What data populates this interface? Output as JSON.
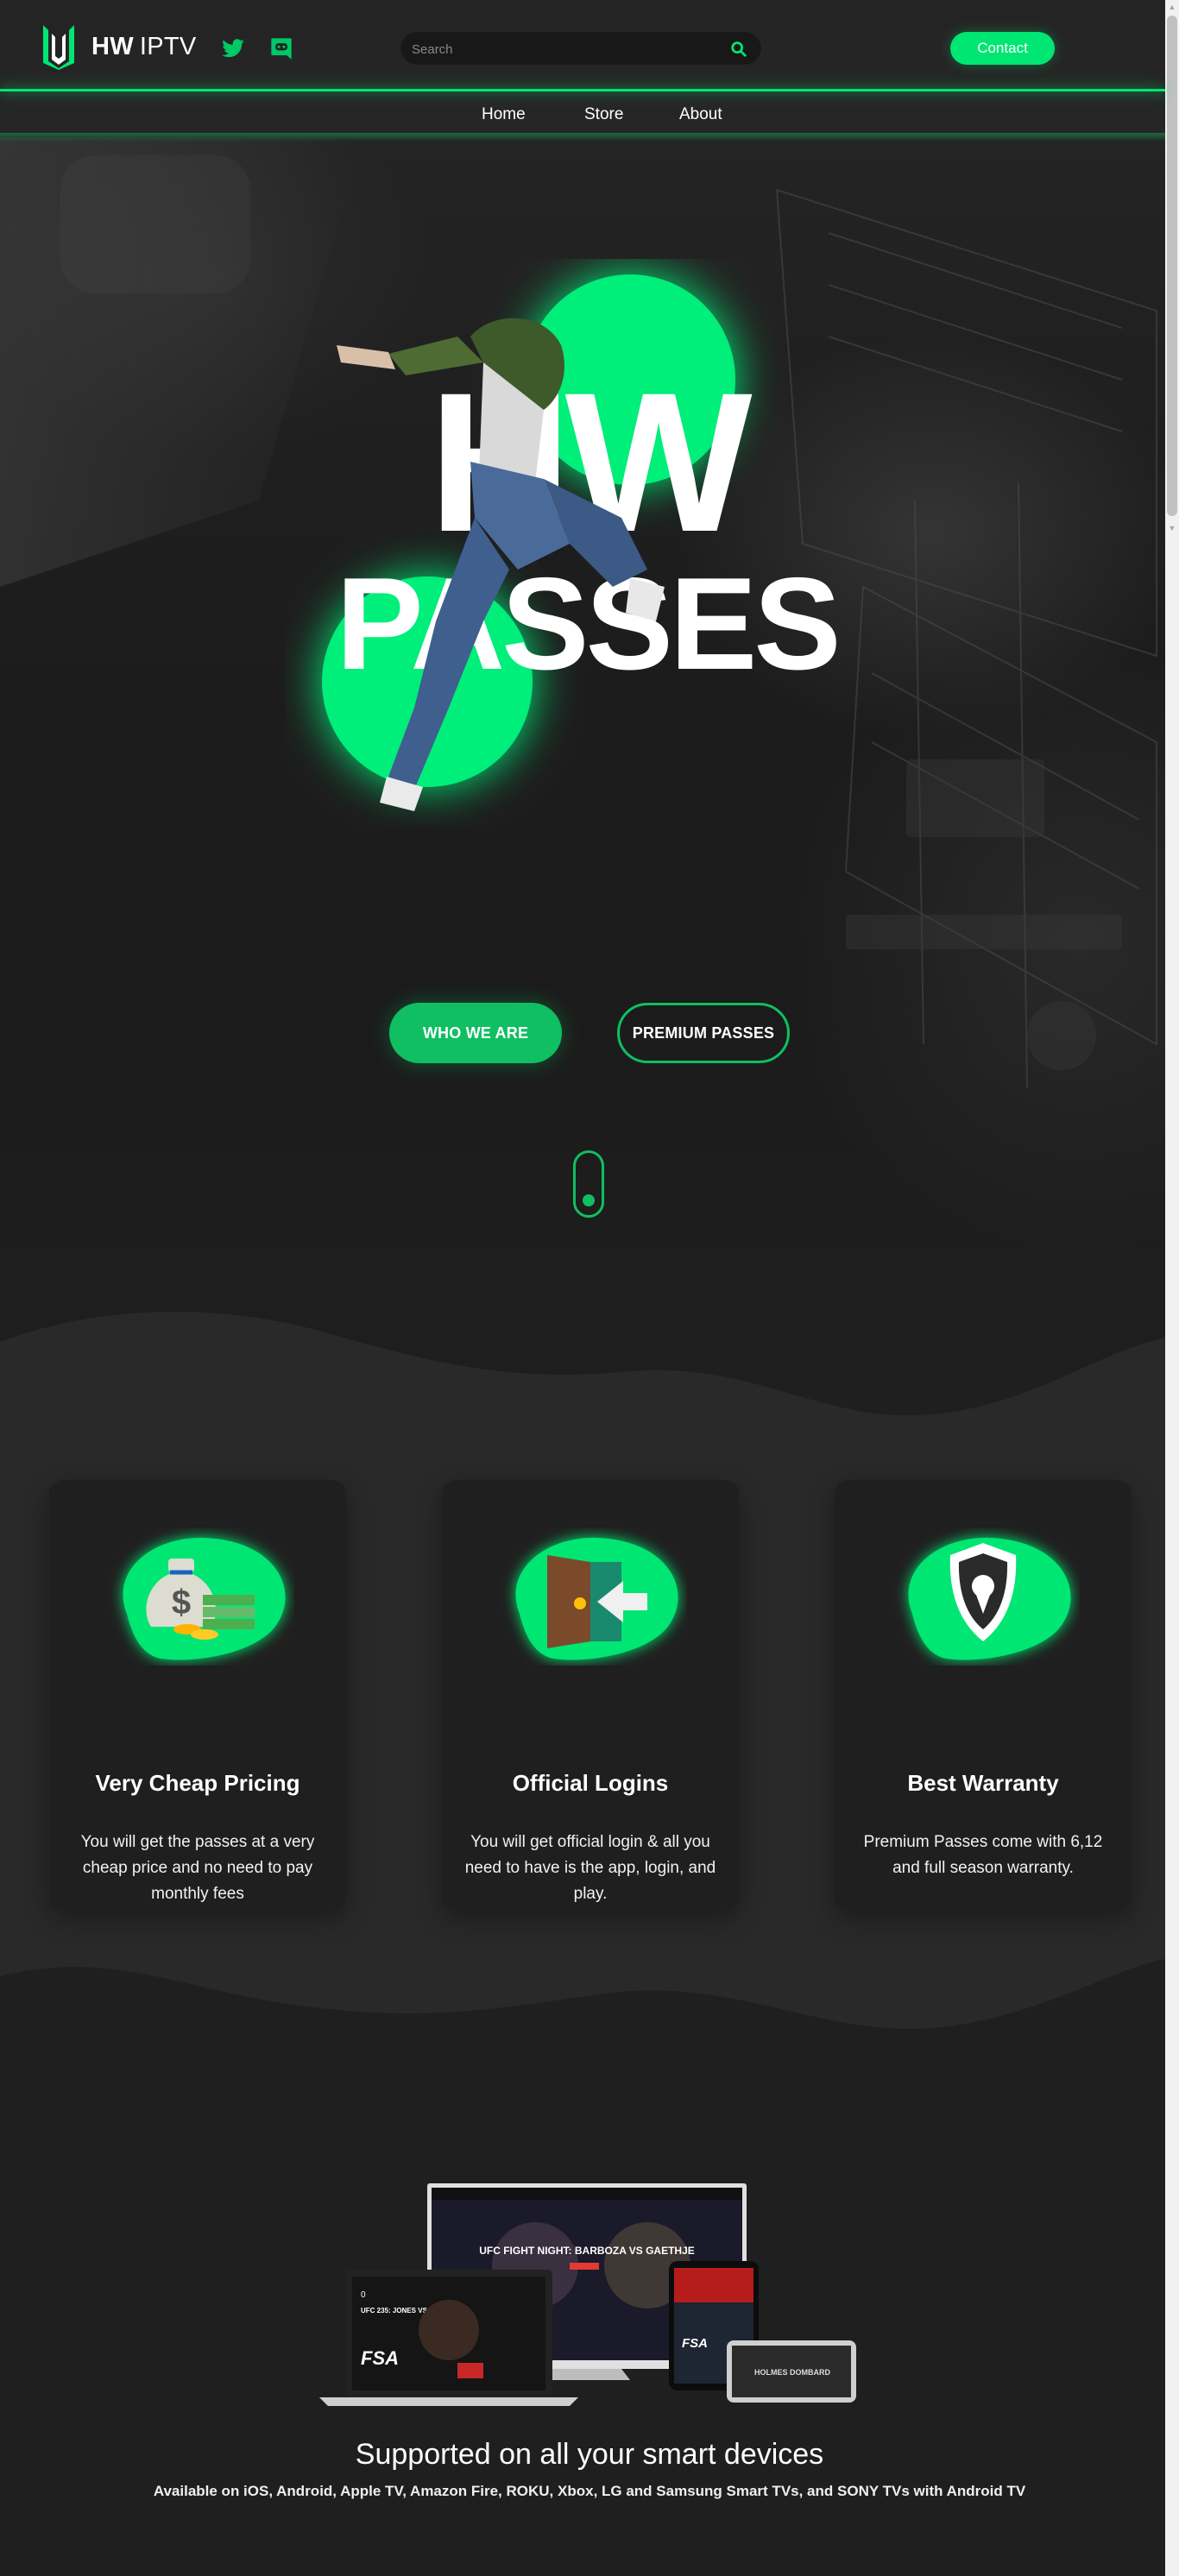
{
  "brand": {
    "name_bold": "HW",
    "name_light": "IPTV",
    "accent": "#00e673",
    "accent_dark": "#0fbf62",
    "background": "#1f1f1f"
  },
  "header": {
    "social": [
      {
        "icon": "twitter-icon"
      },
      {
        "icon": "discord-icon"
      }
    ],
    "search": {
      "placeholder": "Search",
      "value": ""
    },
    "contact_label": "Contact"
  },
  "nav": {
    "items": [
      {
        "label": "Home"
      },
      {
        "label": "Store"
      },
      {
        "label": "About"
      }
    ]
  },
  "hero": {
    "title_line1": "HW",
    "title_line2": "PASSES",
    "primary_button": "WHO WE ARE",
    "secondary_button": "PREMIUM PASSES"
  },
  "features": [
    {
      "icon": "money-bag-icon",
      "title": "Very Cheap Pricing",
      "text": "You will get the passes at a very cheap price and no need to pay monthly fees"
    },
    {
      "icon": "login-door-icon",
      "title": "Official Logins",
      "text": "You will get official login & all you need to have is the app, login, and play."
    },
    {
      "icon": "shield-icon",
      "title": "Best Warranty",
      "text": "Premium Passes come with 6,12 and full season warranty."
    }
  ],
  "devices": {
    "heading": "Supported on all your smart devices",
    "subheading": "Available on iOS, Android, Apple TV, Amazon Fire, ROKU, Xbox, LG and Samsung Smart TVs, and SONY TVs with Android TV",
    "screens": {
      "tv_headline": "UFC FIGHT NIGHT: BARBOZA VS GAETHJE",
      "laptop_headline": "UFC 235: JONES VS SMITH",
      "laptop_counter": "0",
      "fsa_logo": "FSA",
      "tablet_poster": "HOLMES DOMBARD"
    }
  }
}
